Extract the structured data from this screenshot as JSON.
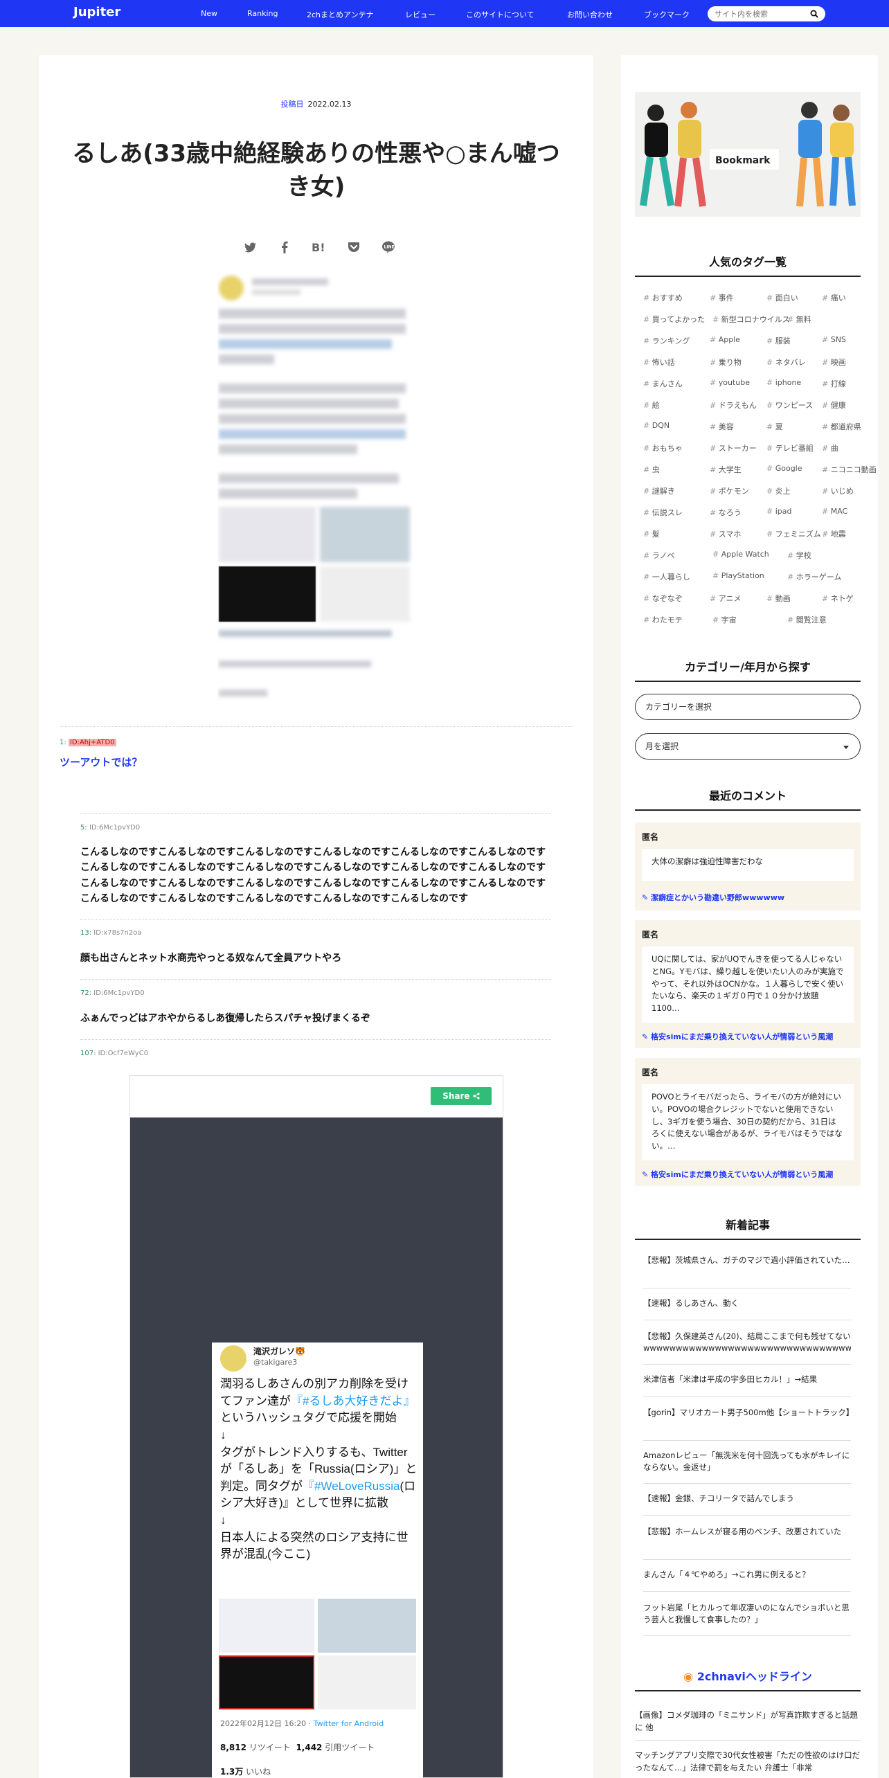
{
  "header": {
    "logo": "Jupiter",
    "nav": [
      "New",
      "Ranking",
      "2chまとめアンテナ",
      "レビュー",
      "このサイトについて",
      "お問い合わせ",
      "ブックマーク"
    ],
    "search_placeholder": "サイト内を検索"
  },
  "post": {
    "date_label": "投稿日",
    "date": "2022.02.13",
    "title": "るしあ(33歳中絶経験ありの性悪や○まん嘘つき女)",
    "share_icons": [
      "twitter-icon",
      "facebook-icon",
      "hatena-icon",
      "pocket-icon",
      "line-icon"
    ],
    "res1": {
      "num": "1",
      "id": "ID:Ahj+ATD0",
      "text": "ツーアウトでは？"
    },
    "res5": {
      "num": "5",
      "id": "ID:6Mc1pvYD0",
      "text": "こんるしなのですこんるしなのですこんるしなのですこんるしなのですこんるしなのですこんるしなのですこんるしなのですこんるしなのですこんるしなのですこんるしなのですこんるしなのですこんるしなのですこんるしなのですこんるしなのですこんるしなのですこんるしなのですこんるしなのですこんるしなのですこんるしなのですこんるしなのですこんるしなのですこんるしなのですこんるしなのです"
    },
    "res13": {
      "num": "13",
      "id": "ID:x78s7n2oa",
      "text": "顔も出さんとネット水商売やっとる奴なんて全員アウトやろ"
    },
    "res72": {
      "num": "72",
      "id": "ID:6Mc1pvYD0",
      "text": "ふぁんでっどはアホやからるしあ復帰したらスパチャ投げまくるぞ"
    },
    "res107": {
      "num": "107",
      "id": "ID:Ocf7eWyC0"
    },
    "video": {
      "share_label": "Share",
      "tweet": {
        "name": "滝沢ガレソ🐯",
        "handle": "@takigare3",
        "text_a": "潤羽るしあさんの別アカ削除を受けてファン達が",
        "tag1": "『#るしあ大好きだよ』",
        "text_b": "というハッシュタグで応援を開始",
        "arrow": "↓",
        "text_c": "タグがトレンド入りするも、Twitterが「るしあ」を「Russia(ロシア)」と判定。同タグが",
        "tag2": "『#WeLoveRussia",
        "text_d": "(ロシア大好き)』として世界に拡散",
        "text_e": "日本人による突然のロシア支持に世界が混乱(今ここ)",
        "date": "2022年02月12日 16:20 · ",
        "client": "Twitter for Android",
        "retweets": "8,812",
        "retweets_label": "リツイート",
        "quotes": "1,442",
        "quotes_label": "引用ツイート",
        "likes": "1.3万",
        "likes_label": "いいね"
      }
    }
  },
  "sidebar": {
    "banner_text": "Bookmark",
    "tags_title": "人気のタグ一覧",
    "tags": [
      [
        "おすすめ",
        "事件",
        "面白い",
        "痛い"
      ],
      [
        "買ってよかった",
        "新型コロナウイルス",
        "無料"
      ],
      [
        "ランキング",
        "Apple",
        "服装",
        "SNS"
      ],
      [
        "怖い話",
        "乗り物",
        "ネタバレ",
        "映画"
      ],
      [
        "まんさん",
        "youtube",
        "iphone",
        "打線"
      ],
      [
        "絵",
        "ドラえもん",
        "ワンピース",
        "健康"
      ],
      [
        "DQN",
        "美容",
        "夏",
        "都道府県"
      ],
      [
        "おもちゃ",
        "ストーカー",
        "テレビ番組",
        "曲"
      ],
      [
        "虫",
        "大学生",
        "Google",
        "ニコニコ動画"
      ],
      [
        "謎解き",
        "ポケモン",
        "炎上",
        "いじめ"
      ],
      [
        "伝説スレ",
        "なろう",
        "ipad",
        "MAC"
      ],
      [
        "髪",
        "スマホ",
        "フェミニズム",
        "地震"
      ],
      [
        "ラノベ",
        "Apple Watch",
        "学校"
      ],
      [
        "一人暮らし",
        "PlayStation",
        "ホラーゲーム"
      ],
      [
        "なぞなぞ",
        "アニメ",
        "動画",
        "ネトゲ"
      ],
      [
        "わたモテ",
        "宇宙",
        "閲覧注意"
      ]
    ],
    "cat_title": "カテゴリー/年月から探す",
    "cat_select": "カテゴリーを選択",
    "month_select": "月を選択",
    "comments_title": "最近のコメント",
    "comments": [
      {
        "name": "匿名",
        "text": "大体の潔癖は強迫性障害だわな",
        "link": "潔癖症とかいう勘違い野郎wwwwww"
      },
      {
        "name": "匿名",
        "text": "UQに関しては、家がUQでんきを使ってる人じゃないとNG。Yモバは、繰り越しを使いたい人のみが実施でやって、それ以外はOCNかな。１人暮らしで安く使いたいなら、楽天の１ギガ０円で１０分かけ放題1100…",
        "link": "格安simにまだ乗り換えていない人が情弱という風潮"
      },
      {
        "name": "匿名",
        "text": "POVOとライモバだったら、ライモバの方が絶対にいい。POVOの場合クレジットでないと使用できないし、3ギガを使う場合、30日の契約だから、31日はろくに使えない場合があるが、ライモバはそうではない。…",
        "link": "格安simにまだ乗り換えていない人が情弱という風潮"
      }
    ],
    "articles_title": "新着記事",
    "articles": [
      "【悲報】茨城県さん、ガチのマジで過小評価されていた…",
      "【速報】るしあさん、動く",
      "【悲報】久保建英さん(20)、結局ここまで何も残せてないwwwwwwwwwwwwwwwwwwwwwwwwwwwwwwwwwwwwwwwwwwwwww",
      "米津信者「米津は平成の宇多田ヒカル！」→結果",
      "【gorin】マリオカート男子500m他【ショートトラック】",
      "Amazonレビュー「無洗米を何十回洗っても水がキレイにならない。金返せ」",
      "【速報】金銀、チコリータで詰んでしまう",
      "【悲報】ホームレスが寝る用のベンチ、改悪されていた",
      "まんさん「４℃やめろ」→これ男に例えると？",
      "フット岩尾「ヒカルって年収凄いのになんでショボいと思う芸人と我慢して食事したの？」"
    ],
    "headline_title": "2chnaviヘッドライン",
    "headlines": [
      "【画像】コメダ珈琲の「ミニサンド」が写真詐欺すぎると話題に 他",
      "マッチングアプリ交際で30代女性被害「ただの性欲のはけ口だったなんて…」法律で罰を与えたい 弁護士「非常"
    ]
  }
}
